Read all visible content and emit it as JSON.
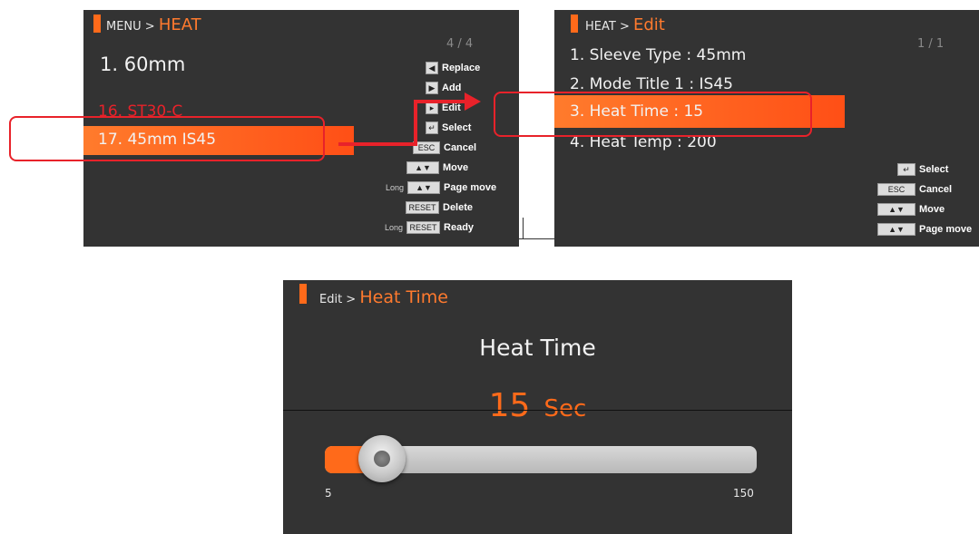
{
  "screen1": {
    "breadcrumb_parent": "MENU >",
    "breadcrumb_current": "HEAT",
    "page_indicator": "4 / 4",
    "items": [
      {
        "label": "1. 60mm"
      },
      {
        "label": "16. ST30-C"
      },
      {
        "label": "17. 45mm IS45"
      }
    ],
    "help": [
      {
        "key": "◀",
        "label": "Replace"
      },
      {
        "key": "▶",
        "label": "Add"
      },
      {
        "key": "▸",
        "label": "Edit"
      },
      {
        "key": "↵",
        "label": "Select"
      },
      {
        "key": "ESC",
        "label": "Cancel"
      },
      {
        "key": "▲▼",
        "label": "Move"
      },
      {
        "prefix": "Long",
        "key": "▲▼",
        "label": "Page move"
      },
      {
        "key": "RESET",
        "label": "Delete"
      },
      {
        "prefix": "Long",
        "key": "RESET",
        "label": "Ready"
      }
    ]
  },
  "screen2": {
    "breadcrumb_parent": "HEAT >",
    "breadcrumb_current": "Edit",
    "page_indicator": "1 / 1",
    "items": [
      {
        "label": "1. Sleeve Type : 45mm"
      },
      {
        "label": "2. Mode Title 1 : IS45"
      },
      {
        "label": "3. Heat Time : 15"
      },
      {
        "label": "4. Heat Temp : 200"
      }
    ],
    "help": [
      {
        "key": "↵",
        "label": "Select"
      },
      {
        "key": "ESC",
        "label": "Cancel"
      },
      {
        "key": "▲▼",
        "label": "Move"
      },
      {
        "key": "▲▼",
        "label": "Page move"
      }
    ]
  },
  "screen3": {
    "breadcrumb_parent": "Edit >",
    "breadcrumb_current": "Heat Time",
    "title": "Heat Time",
    "value": "15",
    "unit": "Sec",
    "slider_min": "5",
    "slider_max": "150",
    "slider_value": 15
  },
  "colors": {
    "accent": "#ff6a1a",
    "screen_bg": "#333333",
    "callout": "#e8222a",
    "red_item": "#e8222a"
  }
}
